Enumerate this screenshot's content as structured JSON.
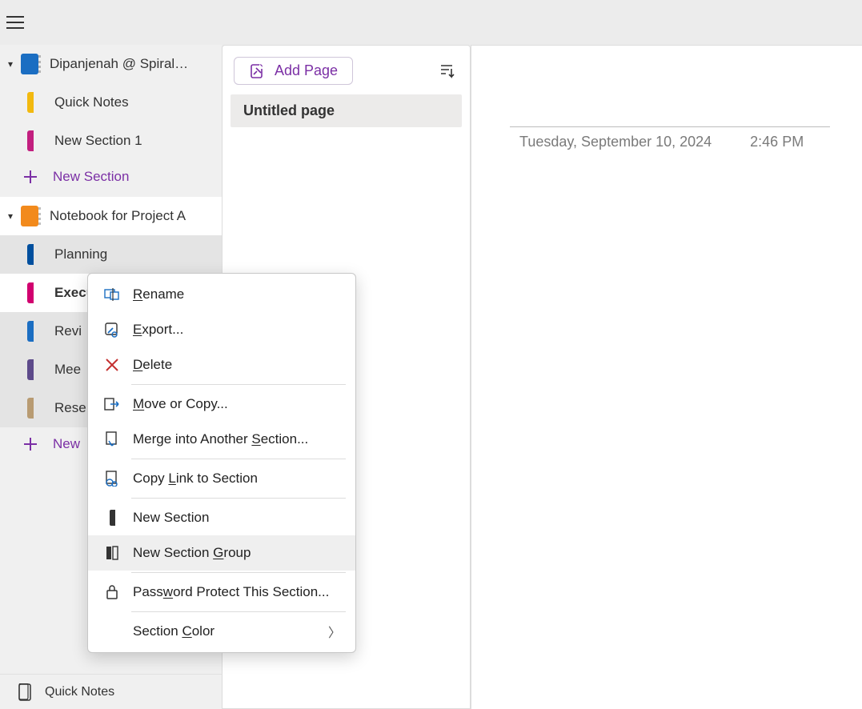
{
  "notebooks": [
    {
      "name": "Dipanjenah @ Spiral…",
      "color": "blue",
      "sections": [
        {
          "label": "Quick Notes",
          "color": "yellow"
        },
        {
          "label": "New Section 1",
          "color": "magenta"
        }
      ],
      "new_section_label": "New Section"
    },
    {
      "name": "Notebook for Project A",
      "color": "orange",
      "sections": [
        {
          "label": "Planning",
          "color": "dblue"
        },
        {
          "label": "Execution",
          "color": "pink",
          "selected": true
        },
        {
          "label": "Revi",
          "color": "blue2"
        },
        {
          "label": "Mee",
          "color": "purple"
        },
        {
          "label": "Rese",
          "color": "tan"
        }
      ],
      "new_section_label": "New"
    }
  ],
  "footer_quick_notes": "Quick Notes",
  "pages": {
    "add_page_label": "Add Page",
    "items": [
      {
        "title": "Untitled page",
        "selected": true
      }
    ]
  },
  "page_meta": {
    "date": "Tuesday, September 10, 2024",
    "time": "2:46 PM"
  },
  "context_menu": {
    "rename": "Rename",
    "export": "Export...",
    "delete": "Delete",
    "move_copy": "Move or Copy...",
    "merge": "Merge into Another Section...",
    "copy_link": "Copy Link to Section",
    "new_section": "New Section",
    "new_section_group": "New Section Group",
    "password": "Password Protect This Section...",
    "section_color": "Section Color"
  }
}
